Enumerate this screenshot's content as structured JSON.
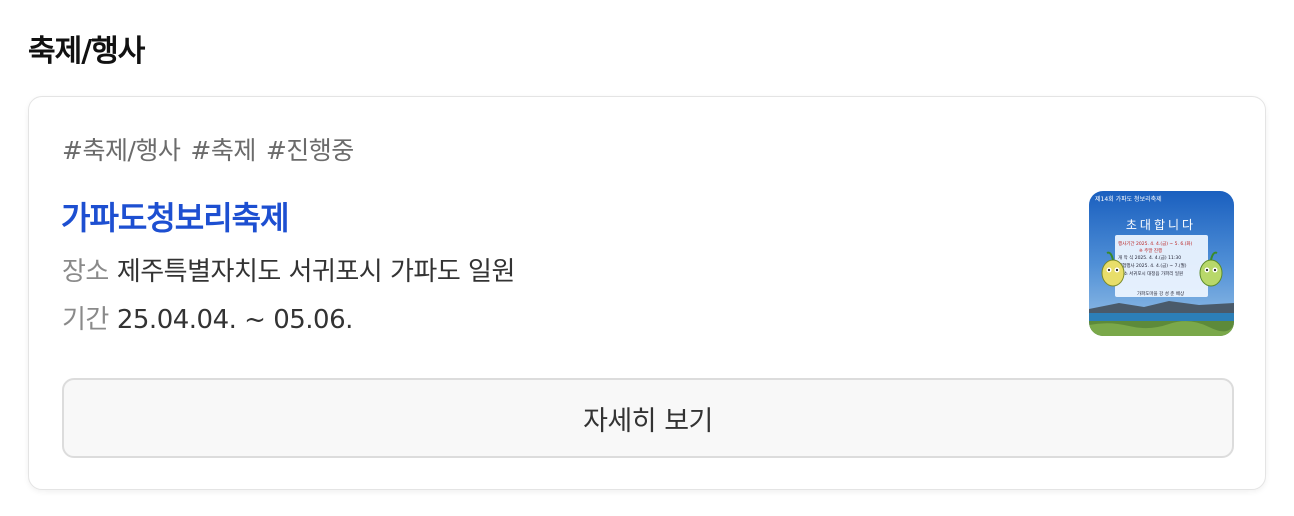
{
  "section": {
    "title": "축제/행사"
  },
  "card": {
    "tags": [
      "#축제/행사",
      "#축제",
      "#진행중"
    ],
    "title": "가파도청보리축제",
    "place_label": "장소",
    "place_value": "제주특별자치도 서귀포시 가파도 일원",
    "period_label": "기간",
    "period_value": "25.04.04. ~ 05.06.",
    "poster": {
      "header_text": "제14회 가파도 청보리축제",
      "invite_text": "초대합니다",
      "line1": "행사기간 2025. 4. 4.(금) ~ 5. 6.(화)",
      "line2": "※ 주말 진행",
      "line3": "개 막 식 2025. 4. 4.(금) 11:30",
      "line4": "체험행사 2025. 4. 4.(금) ~ 7.(월)",
      "line5": "장 소 서귀포시 대정읍 가파리 일원",
      "sign": "가파도마을 강 성 춘 배상"
    },
    "detail_button_label": "자세히 보기"
  },
  "colors": {
    "title_blue": "#1d4fd1",
    "tag_gray": "#6b6b6b",
    "label_gray": "#8a8a8a",
    "button_bg": "#f8f8f8"
  }
}
